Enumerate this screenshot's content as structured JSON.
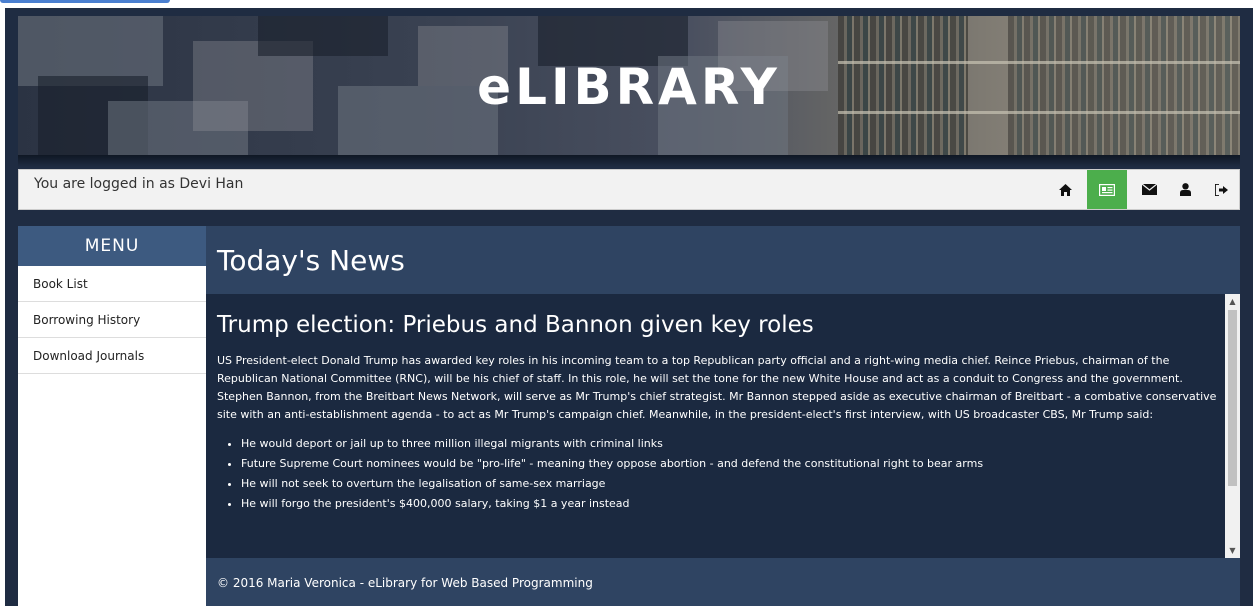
{
  "banner": {
    "title": "eLIBRARY"
  },
  "status": {
    "logged_in_text": "You are logged in as Devi Han"
  },
  "nav": [
    {
      "name": "home-icon",
      "active": false
    },
    {
      "name": "news-icon",
      "active": true
    },
    {
      "name": "envelope-icon",
      "active": false
    },
    {
      "name": "user-icon",
      "active": false
    },
    {
      "name": "logout-icon",
      "active": false
    }
  ],
  "colors": {
    "frame": "#1f2c42",
    "panel": "#2f4462",
    "article_bg": "#1b2940",
    "menu_head": "#3d5a80",
    "active_nav": "#4cae4c"
  },
  "sidebar": {
    "heading": "MENU",
    "items": [
      {
        "label": "Book List"
      },
      {
        "label": "Borrowing History"
      },
      {
        "label": "Download Journals"
      }
    ]
  },
  "main": {
    "title": "Today's News",
    "article": {
      "headline": "Trump election: Priebus and Bannon given key roles",
      "body": "US President-elect Donald Trump has awarded key roles in his incoming team to a top Republican party official and a right-wing media chief. Reince Priebus, chairman of the Republican National Committee (RNC), will be his chief of staff. In this role, he will set the tone for the new White House and act as a conduit to Congress and the government. Stephen Bannon, from the Breitbart News Network, will serve as Mr Trump's chief strategist. Mr Bannon stepped aside as executive chairman of Breitbart - a combative conservative site with an anti-establishment agenda - to act as Mr Trump's campaign chief. Meanwhile, in the president-elect's first interview, with US broadcaster CBS, Mr Trump said:",
      "bullets": [
        "He would deport or jail up to three million illegal migrants with criminal links",
        "Future Supreme Court nominees would be \"pro-life\" - meaning they oppose abortion - and defend the constitutional right to bear arms",
        "He will not seek to overturn the legalisation of same-sex marriage",
        "He will forgo the president's $400,000 salary, taking $1 a year instead"
      ]
    }
  },
  "footer": {
    "text": "© 2016 Maria Veronica - eLibrary for Web Based Programming"
  }
}
